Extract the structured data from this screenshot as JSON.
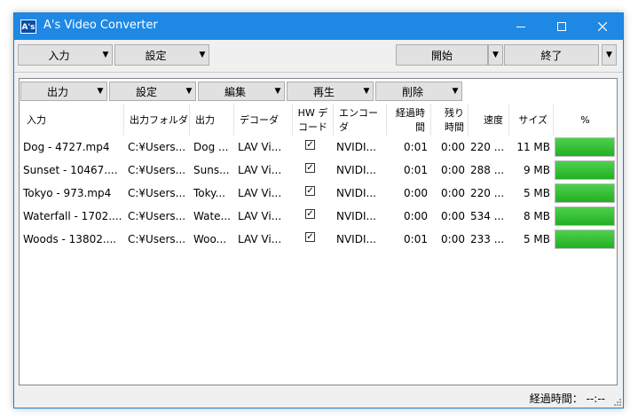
{
  "window": {
    "title": "A's Video Converter",
    "app_icon_text": "A's"
  },
  "toolbar": {
    "input_label": "入力",
    "settings_label": "設定",
    "start_label": "開始",
    "end_label": "終了"
  },
  "panel_toolbar": {
    "output_label": "出力",
    "settings_label": "設定",
    "edit_label": "編集",
    "play_label": "再生",
    "delete_label": "削除"
  },
  "columns": {
    "input": "入力",
    "output_folder": "出力フォルダ",
    "output": "出力",
    "decoder": "デコーダ",
    "hw_decode_1": "HW デ",
    "hw_decode_2": "コード",
    "encoder": "エンコーダ",
    "elapsed_1": "経過時",
    "elapsed_2": "間",
    "remaining_1": "残り",
    "remaining_2": "時間",
    "speed": "速度",
    "size": "サイズ",
    "percent": "%"
  },
  "rows": [
    {
      "input": "Dog - 4727.mp4",
      "folder": "C:¥Users...",
      "output": "Dog ...",
      "decoder": "LAV Vi...",
      "hw": true,
      "encoder": "NVIDI...",
      "elapsed": "0:01",
      "remaining": "0:00",
      "speed": "220 ...",
      "size": "11 MB",
      "progress": 1.0
    },
    {
      "input": "Sunset - 10467....",
      "folder": "C:¥Users...",
      "output": "Suns...",
      "decoder": "LAV Vi...",
      "hw": true,
      "encoder": "NVIDI...",
      "elapsed": "0:01",
      "remaining": "0:00",
      "speed": "288 ...",
      "size": "9 MB",
      "progress": 1.0
    },
    {
      "input": "Tokyo - 973.mp4",
      "folder": "C:¥Users...",
      "output": "Toky...",
      "decoder": "LAV Vi...",
      "hw": true,
      "encoder": "NVIDI...",
      "elapsed": "0:00",
      "remaining": "0:00",
      "speed": "220 ...",
      "size": "5 MB",
      "progress": 1.0
    },
    {
      "input": "Waterfall - 1702....",
      "folder": "C:¥Users...",
      "output": "Wate...",
      "decoder": "LAV Vi...",
      "hw": true,
      "encoder": "NVIDI...",
      "elapsed": "0:00",
      "remaining": "0:00",
      "speed": "534 ...",
      "size": "8 MB",
      "progress": 1.0
    },
    {
      "input": "Woods - 13802....",
      "folder": "C:¥Users...",
      "output": "Woo...",
      "decoder": "LAV Vi...",
      "hw": true,
      "encoder": "NVIDI...",
      "elapsed": "0:01",
      "remaining": "0:00",
      "speed": "233 ...",
      "size": "5 MB",
      "progress": 1.0
    }
  ],
  "status": {
    "elapsed_label": "経過時間：",
    "elapsed_value": "--:--"
  },
  "colors": {
    "titlebar": "#1e88e5",
    "progress": "#22b022"
  }
}
